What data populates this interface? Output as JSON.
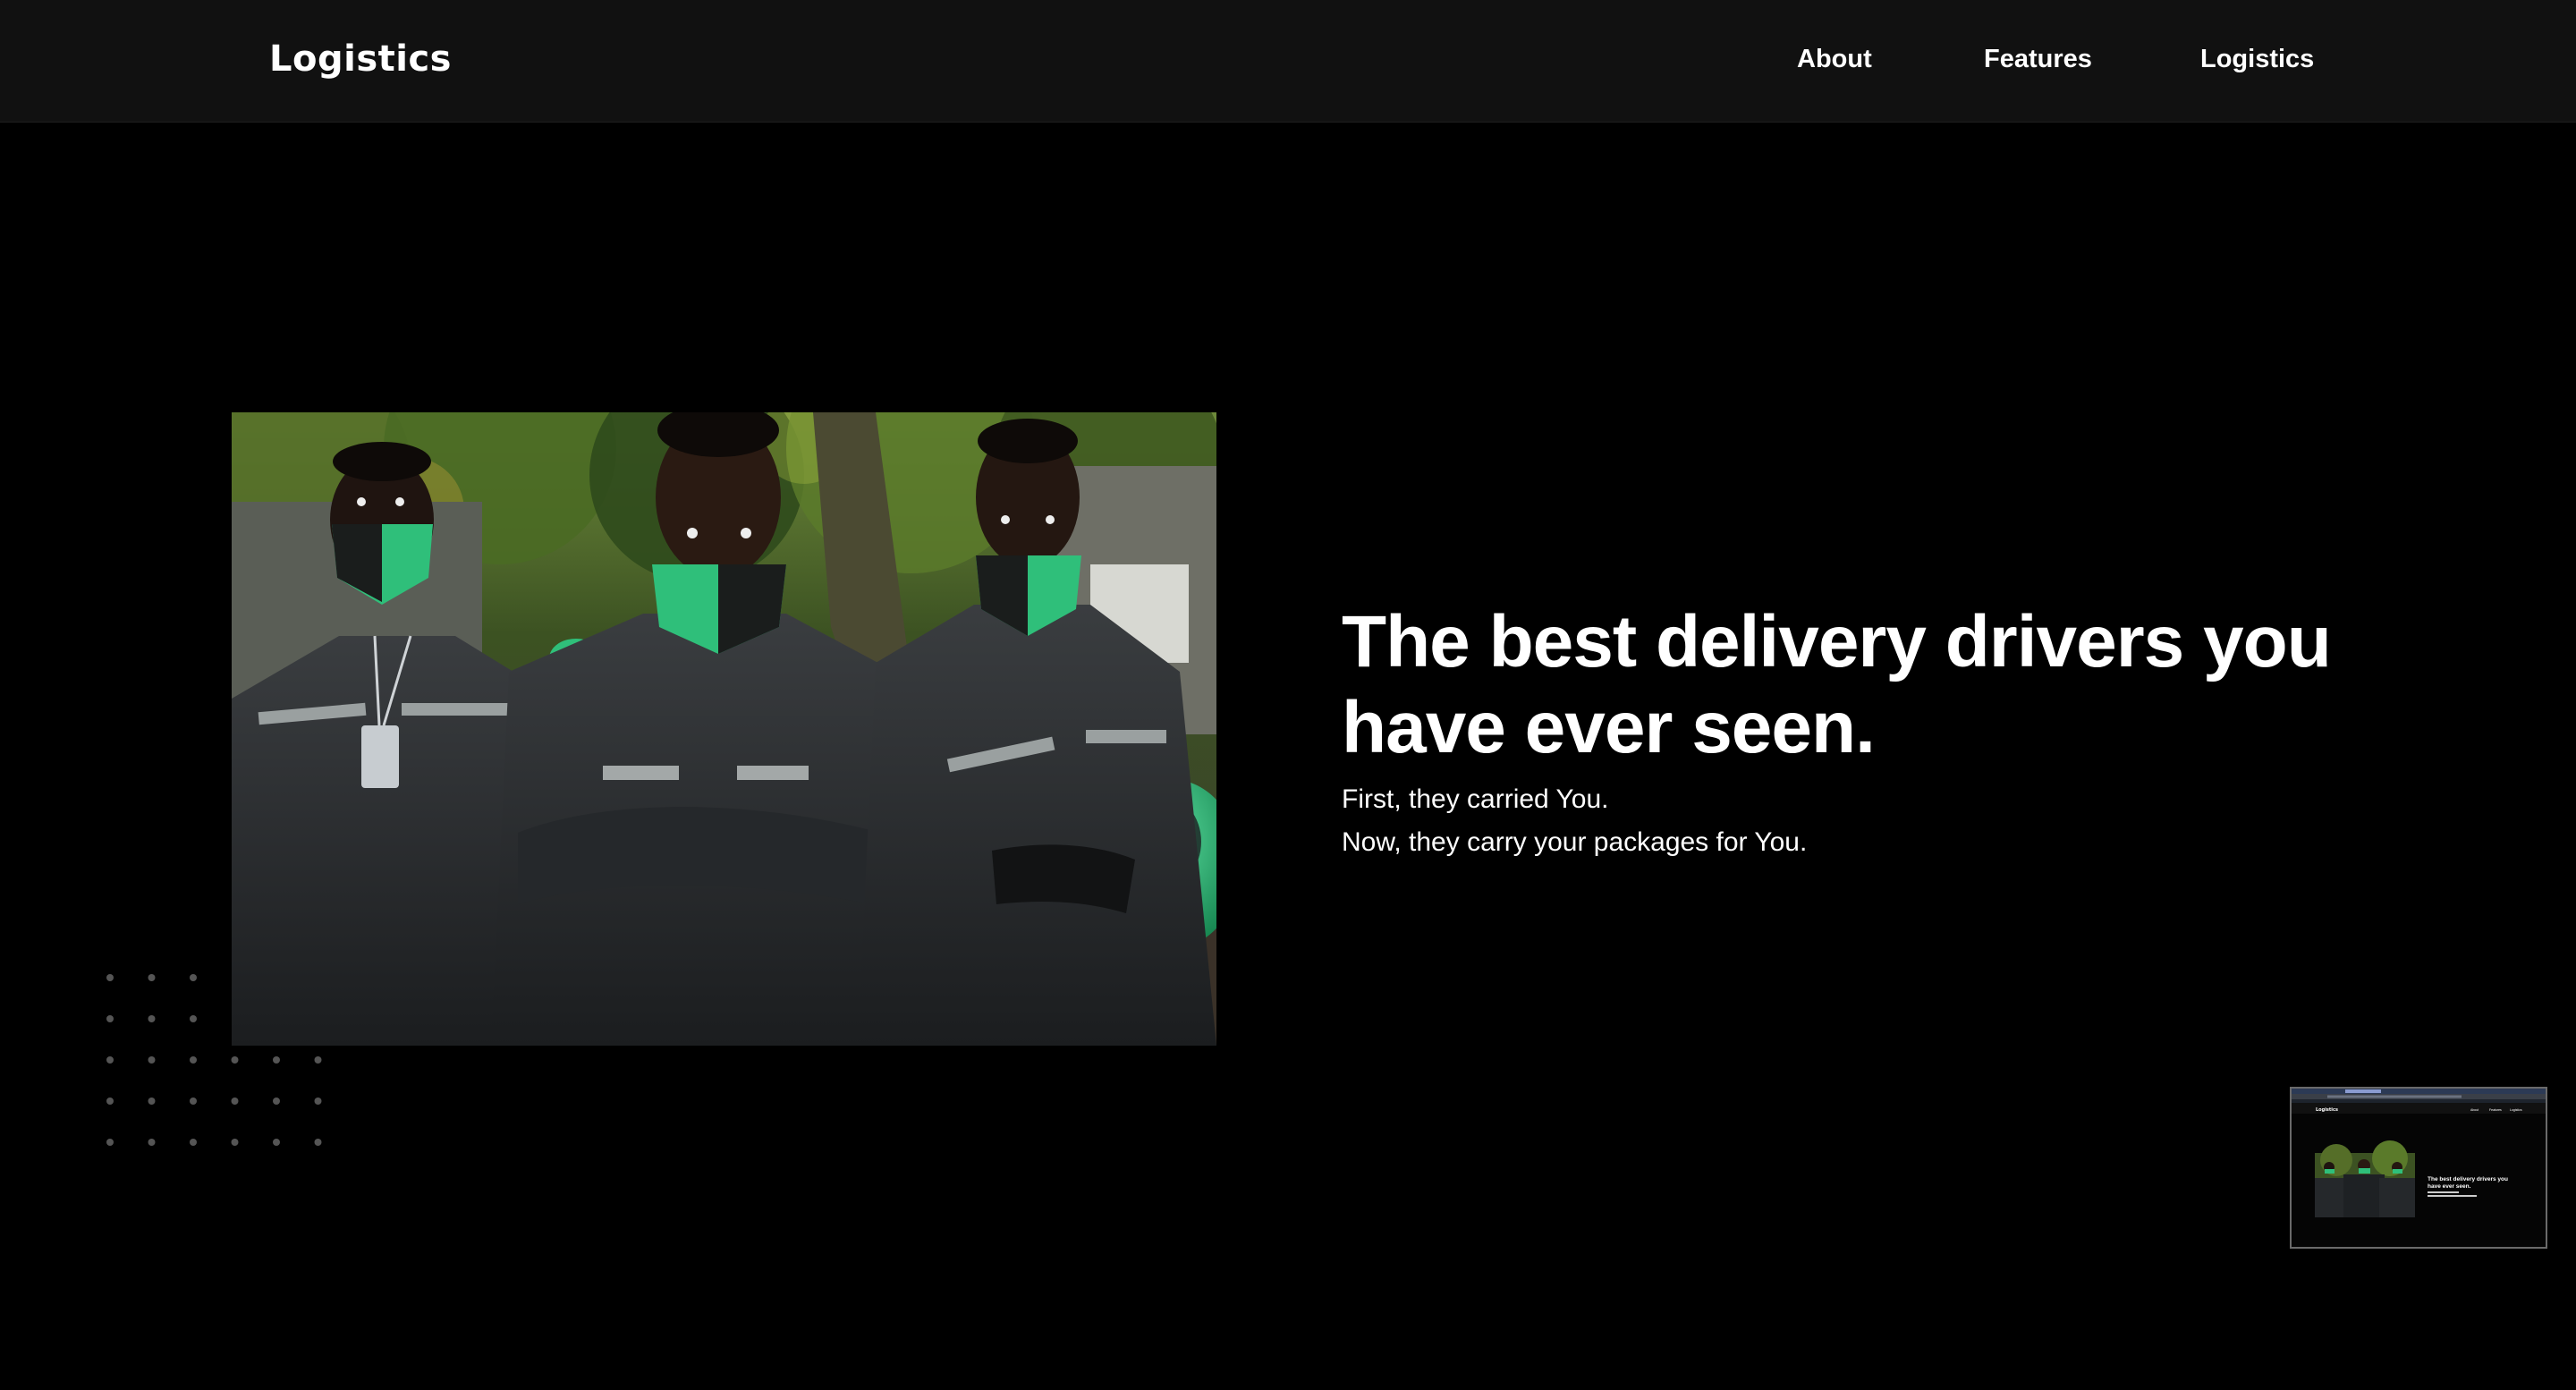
{
  "header": {
    "brand": "Logistics",
    "nav": [
      {
        "label": "About"
      },
      {
        "label": "Features"
      },
      {
        "label": "Logistics"
      }
    ]
  },
  "hero": {
    "headline": "The best delivery drivers you have ever seen.",
    "sub_lines": [
      "First, they carried You.",
      "Now, they carry your packages for You."
    ],
    "image_alt": "Three delivery riders in dark rain jackets and green face masks holding green helmets"
  },
  "thumbnail": {
    "brand": "Logistics",
    "nav": [
      "About",
      "Features",
      "Logistics"
    ],
    "headline_1": "The best delivery drivers you",
    "headline_2": "have ever seen."
  },
  "colors": {
    "background": "#000000",
    "header_bg": "#111111",
    "accent_green": "#2fbf7a",
    "dot": "#555555"
  },
  "icons": {
    "decoration": "dot-grid"
  }
}
